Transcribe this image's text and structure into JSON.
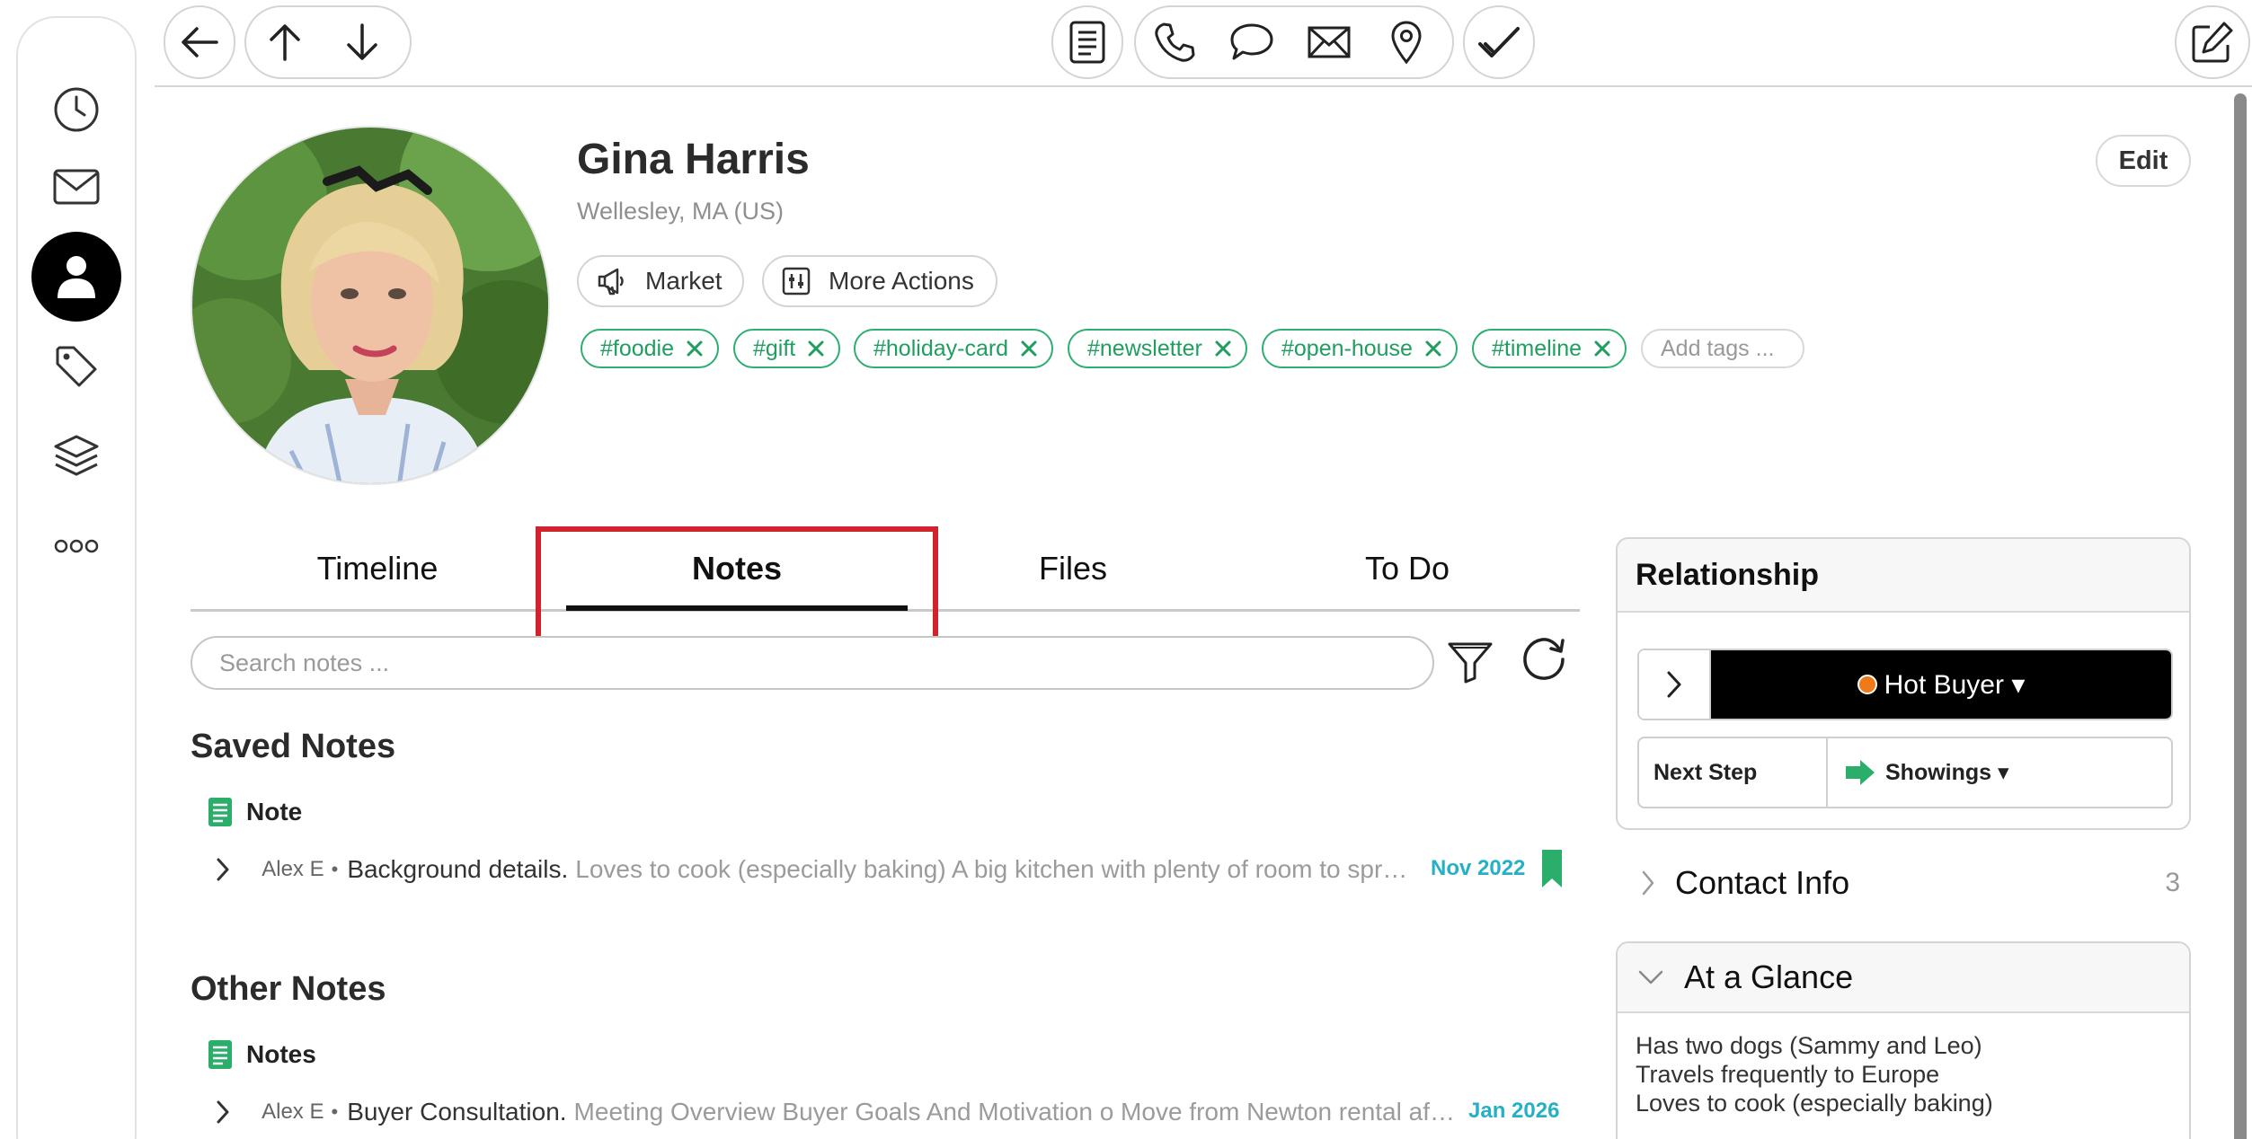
{
  "sidebar": {
    "items": [
      {
        "name": "history"
      },
      {
        "name": "mail"
      },
      {
        "name": "contacts",
        "active": true
      },
      {
        "name": "tags"
      },
      {
        "name": "layers"
      },
      {
        "name": "more"
      }
    ]
  },
  "toolbar": {
    "left": [
      "back-arrow-icon",
      "arrow-up-icon",
      "arrow-down-icon"
    ],
    "center": [
      "notes-icon",
      "phone-icon",
      "chat-bubble-icon",
      "envelope-icon",
      "location-pin-icon",
      "check-icon"
    ],
    "right": [
      "edit-compose-icon"
    ]
  },
  "contact": {
    "name": "Gina Harris",
    "location": "Wellesley, MA (US)",
    "edit_label": "Edit",
    "actions": {
      "market": "Market",
      "more": "More Actions"
    },
    "tags": [
      "#foodie",
      "#gift",
      "#holiday-card",
      "#newsletter",
      "#open-house",
      "#timeline"
    ],
    "add_tags_placeholder": "Add tags ..."
  },
  "tabs": {
    "items": [
      "Timeline",
      "Notes",
      "Files",
      "To Do"
    ],
    "active": "Notes"
  },
  "search": {
    "placeholder": "Search notes ..."
  },
  "saved_notes": {
    "title": "Saved Notes",
    "category": "Note",
    "items": [
      {
        "author": "Alex E",
        "title": "Background details.",
        "preview": "Loves to cook (especially baking) A big kitchen with plenty of room to spread...",
        "date": "Nov 2022",
        "bookmarked": true
      }
    ]
  },
  "other_notes": {
    "title": "Other Notes",
    "category": "Notes",
    "items": [
      {
        "author": "Alex E",
        "title": "Buyer Consultation.",
        "preview": "Meeting Overview Buyer Goals And Motivation o Move from Newton rental after ...",
        "date": "Jan 2026"
      }
    ]
  },
  "relationship": {
    "title": "Relationship",
    "status": "Hot Buyer ▾",
    "status_color": "#ef7a1a",
    "next_step_label": "Next Step",
    "next_step_value": "Showings ▾"
  },
  "contact_info": {
    "label": "Contact Info",
    "count": "3"
  },
  "glance": {
    "title": "At a Glance",
    "lines": [
      "Has two dogs (Sammy and Leo)",
      "Travels frequently to Europe",
      "Loves to cook (especially baking)"
    ]
  },
  "colors": {
    "tag_green": "#1f9e60",
    "date_blue": "#26b0c7",
    "highlight_red": "#d1222d",
    "note_icon_green": "#2aae6a"
  }
}
